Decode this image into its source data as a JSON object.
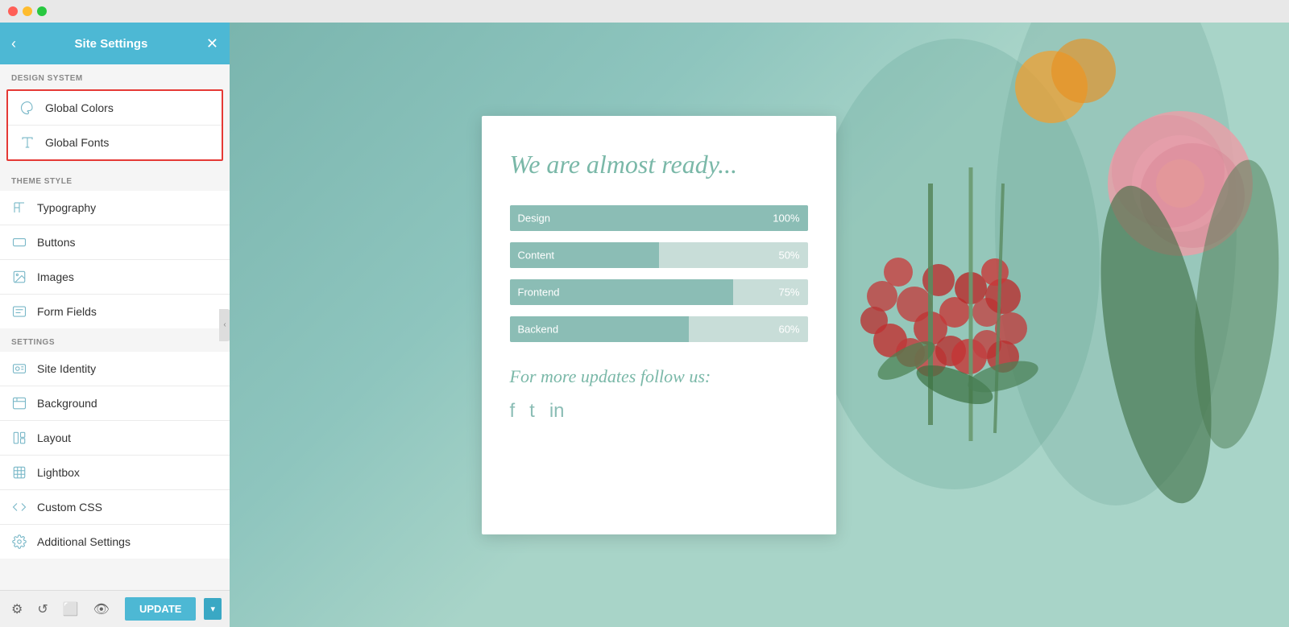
{
  "titlebar": {
    "buttons": [
      "close",
      "minimize",
      "maximize"
    ]
  },
  "sidebar": {
    "header": {
      "title": "Site Settings",
      "back_label": "‹",
      "close_label": "✕"
    },
    "design_system": {
      "section_label": "DESIGN SYSTEM",
      "items": [
        {
          "id": "global-colors",
          "label": "Global Colors",
          "icon": "palette"
        },
        {
          "id": "global-fonts",
          "label": "Global Fonts",
          "icon": "font"
        }
      ]
    },
    "theme_style": {
      "section_label": "THEME STYLE",
      "items": [
        {
          "id": "typography",
          "label": "Typography",
          "icon": "heading"
        },
        {
          "id": "buttons",
          "label": "Buttons",
          "icon": "button"
        },
        {
          "id": "images",
          "label": "Images",
          "icon": "image"
        },
        {
          "id": "form-fields",
          "label": "Form Fields",
          "icon": "form"
        }
      ]
    },
    "settings": {
      "section_label": "SETTINGS",
      "items": [
        {
          "id": "site-identity",
          "label": "Site Identity",
          "icon": "identity"
        },
        {
          "id": "background",
          "label": "Background",
          "icon": "background"
        },
        {
          "id": "layout",
          "label": "Layout",
          "icon": "layout"
        },
        {
          "id": "lightbox",
          "label": "Lightbox",
          "icon": "lightbox"
        },
        {
          "id": "custom-css",
          "label": "Custom CSS",
          "icon": "css"
        },
        {
          "id": "additional-settings",
          "label": "Additional Settings",
          "icon": "settings"
        }
      ]
    },
    "toolbar": {
      "update_label": "UPDATE",
      "dropdown_label": "▾"
    }
  },
  "preview": {
    "title": "We are almost ready...",
    "progress_bars": [
      {
        "label": "Design",
        "pct": 100,
        "pct_label": "100%"
      },
      {
        "label": "Content",
        "pct": 50,
        "pct_label": "50%"
      },
      {
        "label": "Frontend",
        "pct": 75,
        "pct_label": "75%"
      },
      {
        "label": "Backend",
        "pct": 60,
        "pct_label": "60%"
      }
    ],
    "subtitle": "For more updates follow us:",
    "social": [
      "f",
      "𝕥",
      "in"
    ]
  }
}
